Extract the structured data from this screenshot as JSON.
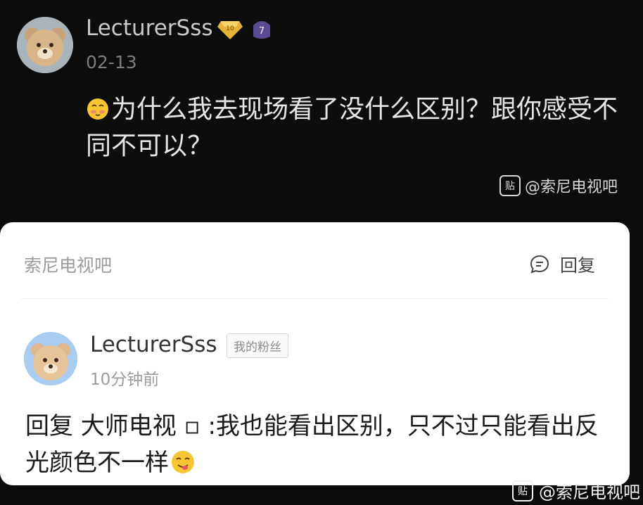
{
  "post": {
    "username": "LecturerSss",
    "badge_level": "10",
    "level_badge": "7",
    "date": "02-13",
    "text": "为什么我去现场看了没什么区别？跟你感受不同不可以？",
    "watermark": "@索尼电视吧",
    "watermark_icon_text": "贴"
  },
  "card": {
    "forum_name": "索尼电视吧",
    "reply_label": "回复",
    "username": "LecturerSss",
    "fan_tag": "我的粉丝",
    "time": "10分钟前",
    "comment": "回复 大师电视 ▫ :我也能看出区别，只不过只能看出反光颜色不一样"
  },
  "footer": {
    "watermark": "@索尼电视吧",
    "watermark_icon_text": "贴"
  },
  "colors": {
    "background": "#0b0b0c",
    "card_bg": "#ffffff",
    "muted": "#9b9b9b"
  },
  "icons": [
    "bear-avatar-icon",
    "gold-badge-icon",
    "level-badge-icon",
    "blush-emoji-icon",
    "reply-icon",
    "yum-emoji-icon",
    "tieba-logo-icon"
  ]
}
